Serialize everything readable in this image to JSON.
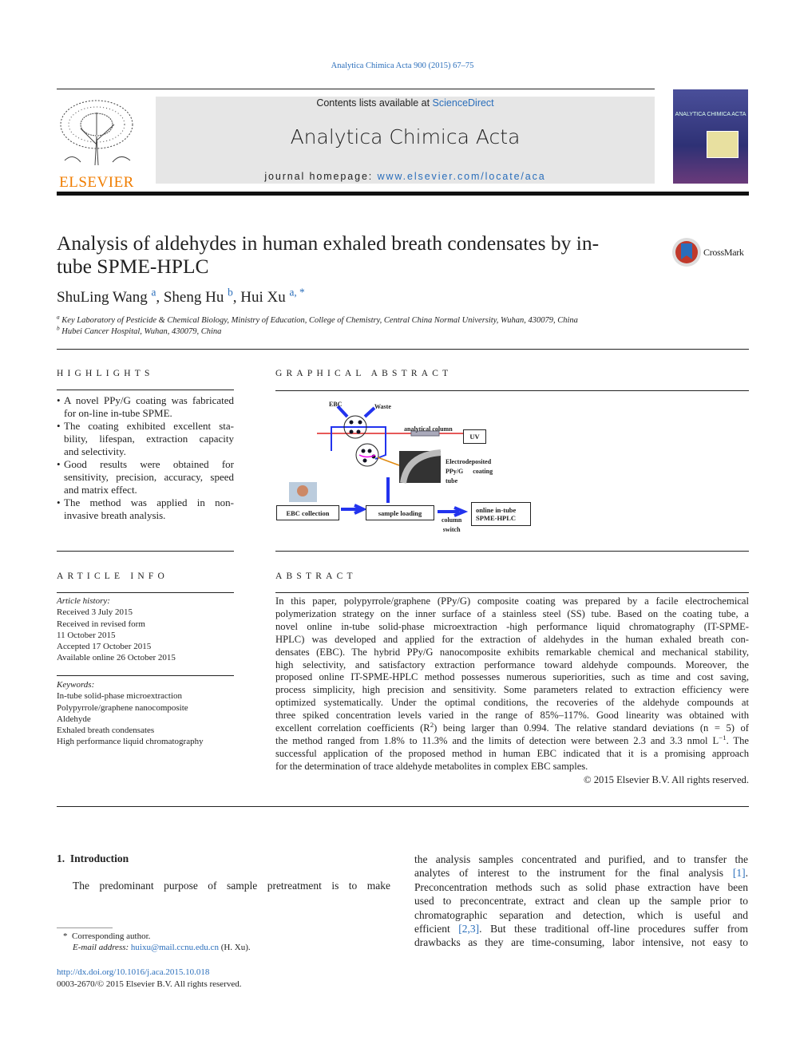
{
  "journal_ref": "Analytica Chimica Acta 900 (2015) 67–75",
  "header": {
    "contents_prefix": "Contents lists available at ",
    "contents_link": "ScienceDirect",
    "journal_title": "Analytica Chimica Acta",
    "homepage_prefix": "journal homepage: ",
    "homepage_link": "www.elsevier.com/locate/aca",
    "publisher": "ELSEVIER",
    "cover_title": "ANALYTICA CHIMICA ACTA"
  },
  "colors": {
    "link": "#2a6ebb",
    "elsevier_orange": "#f07d00",
    "header_box": "#e6e6e6",
    "cover": "#3a3f8f"
  },
  "title_lines": [
    "Analysis of aldehydes in human exhaled breath condensates by in-",
    "tube SPME-HPLC"
  ],
  "crossmark": "CrossMark",
  "authors": [
    {
      "name": "ShuLing Wang",
      "sup": "a"
    },
    {
      "name": "Sheng Hu",
      "sup": "b"
    },
    {
      "name": "Hui Xu",
      "sup": "a, *"
    }
  ],
  "affiliations": [
    {
      "sup": "a",
      "text": "Key Laboratory of Pesticide & Chemical Biology, Ministry of Education, College of Chemistry, Central China Normal University, Wuhan, 430079, China"
    },
    {
      "sup": "b",
      "text": "Hubei Cancer Hospital, Wuhan, 430079, China"
    }
  ],
  "highlights": {
    "heading": "HIGHLIGHTS",
    "items": [
      [
        "A novel PPy/G coating was fabricated",
        "for on-line in-tube SPME."
      ],
      [
        "The coating exhibited excellent sta-",
        "bility, lifespan, extraction capacity",
        "and selectivity."
      ],
      [
        "Good results were obtained for",
        "sensitivity, precision, accuracy, speed",
        "and matrix effect."
      ],
      [
        "The method was applied in non-",
        "invasive breath analysis."
      ]
    ]
  },
  "graphical_abstract": {
    "heading": "GRAPHICAL ABSTRACT",
    "labels": {
      "ebc": "EBC",
      "waste": "Waste",
      "column": "analytical column",
      "uv": "UV",
      "coating": [
        "Electrodeposited",
        "PPy/G      coating",
        "tube"
      ],
      "ebc_collection": "EBC collection",
      "sample_loading": "sample loading",
      "column_switch": [
        "column",
        "switch"
      ],
      "online": [
        "online in-tube",
        "SPME-HPLC"
      ]
    }
  },
  "article_info": {
    "heading": "ARTICLE INFO",
    "history_label": "Article history:",
    "history": [
      "Received 3 July 2015",
      "Received in revised form",
      "11 October 2015",
      "Accepted 17 October 2015",
      "Available online 26 October 2015"
    ],
    "keywords_label": "Keywords:",
    "keywords": [
      "In-tube solid-phase microextraction",
      "Polypyrrole/graphene nanocomposite",
      "Aldehyde",
      "Exhaled breath condensates",
      "High performance liquid chromatography"
    ]
  },
  "abstract": {
    "heading": "ABSTRACT",
    "lines": [
      [
        "In this paper, polypyrrole/graphene (PPy/G) composite coating was prepared by a facile electrochemical"
      ],
      [
        "polymerization strategy on the inner surface of a stainless steel (SS) tube. Based on the coating tube, a"
      ],
      [
        "novel online in-tube solid-phase microextraction -high performance liquid chromatography (IT-SPME-"
      ],
      [
        "HPLC) was developed and applied for the extraction of aldehydes in the human exhaled breath con-"
      ],
      [
        "densates (EBC). The hybrid PPy/G nanocomposite exhibits remarkable chemical and mechanical stability,"
      ],
      [
        "high selectivity, and satisfactory extraction performance toward aldehyde compounds. Moreover, the"
      ],
      [
        "proposed online IT-SPME-HPLC method possesses numerous superiorities, such as time and cost saving,"
      ],
      [
        "process simplicity, high precision and sensitivity. Some parameters related to extraction efficiency were"
      ],
      [
        "optimized systematically. Under the optimal conditions, the recoveries of the aldehyde compounds at"
      ],
      [
        "three spiked concentration levels varied in the range of 85%–117%. Good linearity was obtained with"
      ],
      [
        "excellent correlation coefficients (R",
        "2",
        ") being larger than 0.994. The relative standard deviations (n = 5) of"
      ],
      [
        "the method ranged from 1.8% to 11.3% and the limits of detection were between 2.3 and 3.3 nmol L",
        "−1",
        ". The"
      ],
      [
        "successful application of the proposed method in human EBC indicated that it is a promising approach"
      ],
      [
        "for the determination of trace aldehyde metabolites in complex EBC samples."
      ]
    ],
    "copyright": "© 2015 Elsevier B.V. All rights reserved."
  },
  "intro": {
    "heading_num": "1.",
    "heading": "Introduction",
    "left_line": "The predominant purpose of sample pretreatment is to make",
    "right_lines": [
      [
        "the analysis samples concentrated and purified, and to transfer the"
      ],
      [
        "analytes of interest to the instrument for the final analysis ",
        "[1]",
        "."
      ],
      [
        "Preconcentration methods such as solid phase extraction have been"
      ],
      [
        "used to preconcentrate, extract and clean up the sample prior to"
      ],
      [
        "chromatographic separation and detection, which is useful and"
      ],
      [
        "efficient ",
        "[2,3]",
        ". But these traditional off-line procedures suffer from"
      ],
      [
        "drawbacks as they are time-consuming, labor intensive, not easy to"
      ]
    ]
  },
  "footnote": {
    "star": "*",
    "corresponding": "Corresponding author.",
    "email_label": "E-mail address: ",
    "email": "huixu@mail.ccnu.edu.cn",
    "email_suffix": " (H. Xu)."
  },
  "doi": "http://dx.doi.org/10.1016/j.aca.2015.10.018",
  "issn": "0003-2670/© 2015 Elsevier B.V. All rights reserved."
}
